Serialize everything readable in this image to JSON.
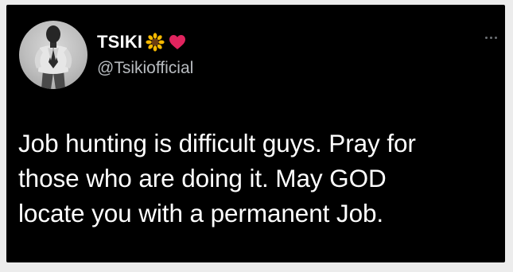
{
  "tweet": {
    "author": {
      "display_name": "TSIKI",
      "name_emojis": [
        "sunflower-icon",
        "red-heart-icon"
      ],
      "handle": "@Tsikiofficial"
    },
    "text_lines": [
      "Job hunting is difficult guys. Pray for",
      "those who are doing it. May GOD",
      "locate you with a permanent Job."
    ]
  },
  "colors": {
    "background": "#ececec",
    "card": "#000000",
    "text": "#ffffff",
    "handle": "#b8bcc0",
    "heart": "#e0245e",
    "sunflower_petals": "#f5b800",
    "sunflower_center": "#6b3d12"
  }
}
